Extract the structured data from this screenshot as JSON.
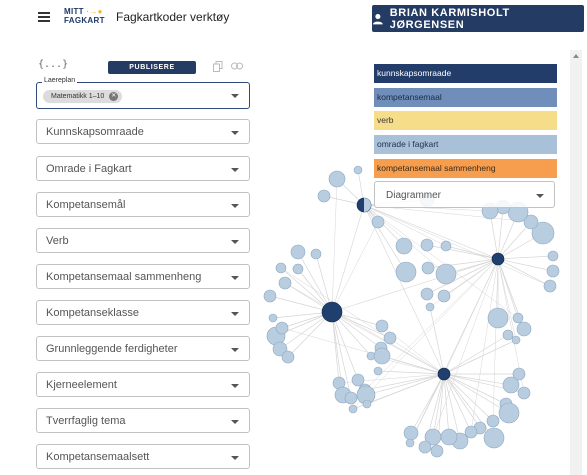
{
  "header": {
    "logo_line1": "MITT",
    "logo_line2": "FAGKART",
    "title": "Fagkartkoder verktøy",
    "user_name": "BRIAN KARMISHOLT JØRGENSEN"
  },
  "toolbar": {
    "braces": "{...}",
    "publish_label": "PUBLISERE"
  },
  "filters": {
    "laereplan_legend": "Laereplan",
    "laereplan_chip": "Matematikk 1–10",
    "items": [
      "Kunnskapsomraade",
      "Omrade i Fagkart",
      "Kompetansemål",
      "Verb",
      "Kompetansemaal sammenheng",
      "Kompetanseklasse",
      "Grunnleggende ferdigheter",
      "Kjerneelement",
      "Tverrfaglig tema",
      "Kompetansemaalsett"
    ]
  },
  "legend": {
    "items": [
      {
        "label": "kunnskapsomraade",
        "bg": "#233d6a",
        "fg": "#ffffff"
      },
      {
        "label": "kompetansemaal",
        "bg": "#6f8fba",
        "fg": "#1a2a44"
      },
      {
        "label": "verb",
        "bg": "#f6dd8a",
        "fg": "#3a3a3a"
      },
      {
        "label": "omrade i fagkart",
        "bg": "#a8c1d8",
        "fg": "#23324d"
      },
      {
        "label": "kompetansemaal sammenheng",
        "bg": "#f79e4e",
        "fg": "#3a2a1a"
      }
    ],
    "diagram_placeholder": "Diagrammer"
  },
  "colors": {
    "accent": "#243b63",
    "node_light": "#b9cde0",
    "node_dark": "#1f3f6e",
    "edge": "#d5d5d5"
  },
  "icons": [
    "menu-icon",
    "person-icon",
    "copy-icon",
    "link-icon",
    "cancel-chip-icon",
    "chevron-down-icon"
  ]
}
